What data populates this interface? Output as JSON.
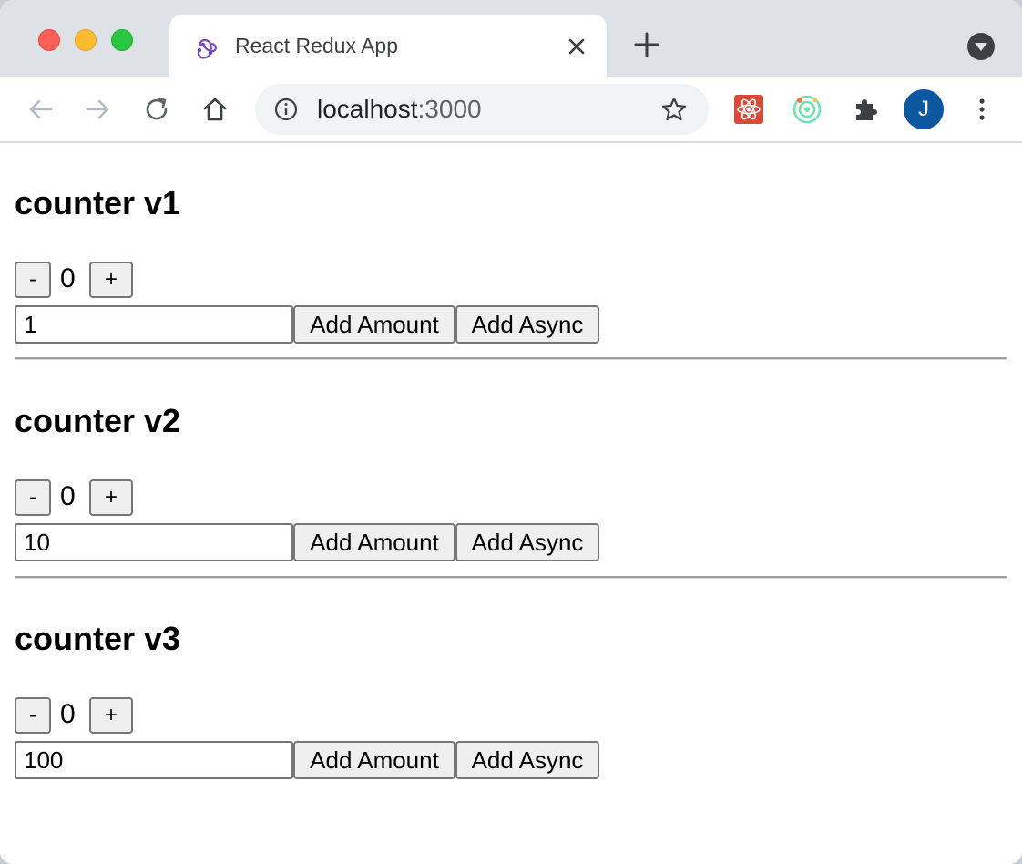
{
  "browser": {
    "tab_title": "React Redux App",
    "tab_icon": "redux-icon",
    "url_host": "localhost",
    "url_port": ":3000",
    "avatar_letter": "J",
    "accent": "#0b57a0"
  },
  "counters": [
    {
      "title": "counter v1",
      "decrement_label": "-",
      "count": "0",
      "increment_label": "+",
      "amount_value": "1",
      "add_amount_label": "Add Amount",
      "add_async_label": "Add Async"
    },
    {
      "title": "counter v2",
      "decrement_label": "-",
      "count": "0",
      "increment_label": "+",
      "amount_value": "10",
      "add_amount_label": "Add Amount",
      "add_async_label": "Add Async"
    },
    {
      "title": "counter v3",
      "decrement_label": "-",
      "count": "0",
      "increment_label": "+",
      "amount_value": "100",
      "add_amount_label": "Add Amount",
      "add_async_label": "Add Async"
    }
  ]
}
